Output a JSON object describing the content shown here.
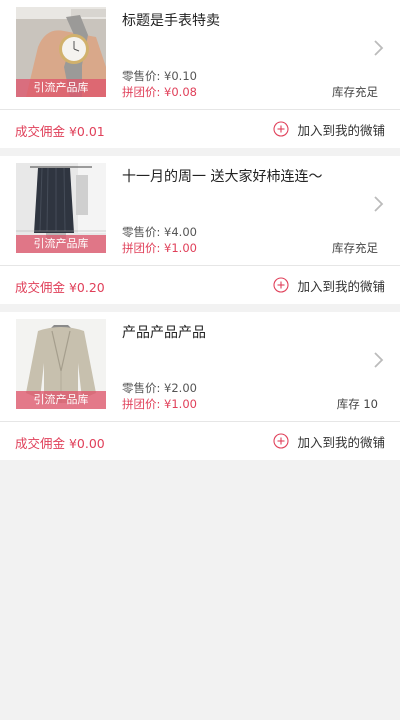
{
  "products": [
    {
      "title": "标题是手表特卖",
      "thumb_label": "引流产品库",
      "retail_price": "零售价: ¥0.10",
      "group_price": "拼团价: ¥0.08",
      "stock": "库存充足",
      "commission": "成交佣金 ¥0.01",
      "add_label": "加入到我的微铺",
      "image_icon": "watch-image"
    },
    {
      "title": "十一月的周一 送大家好柿连连～",
      "thumb_label": "引流产品库",
      "retail_price": "零售价: ¥4.00",
      "group_price": "拼团价: ¥1.00",
      "stock": "库存充足",
      "commission": "成交佣金 ¥0.20",
      "add_label": "加入到我的微铺",
      "image_icon": "clothing-rack-image"
    },
    {
      "title": "产品产品产品",
      "thumb_label": "引流产品库",
      "retail_price": "零售价: ¥2.00",
      "group_price": "拼团价: ¥1.00",
      "stock": "库存 10",
      "commission": "成交佣金 ¥0.00",
      "add_label": "加入到我的微铺",
      "image_icon": "coat-image"
    }
  ],
  "colors": {
    "accent": "#e0405a",
    "background": "#f2f2f2",
    "card": "#ffffff"
  }
}
